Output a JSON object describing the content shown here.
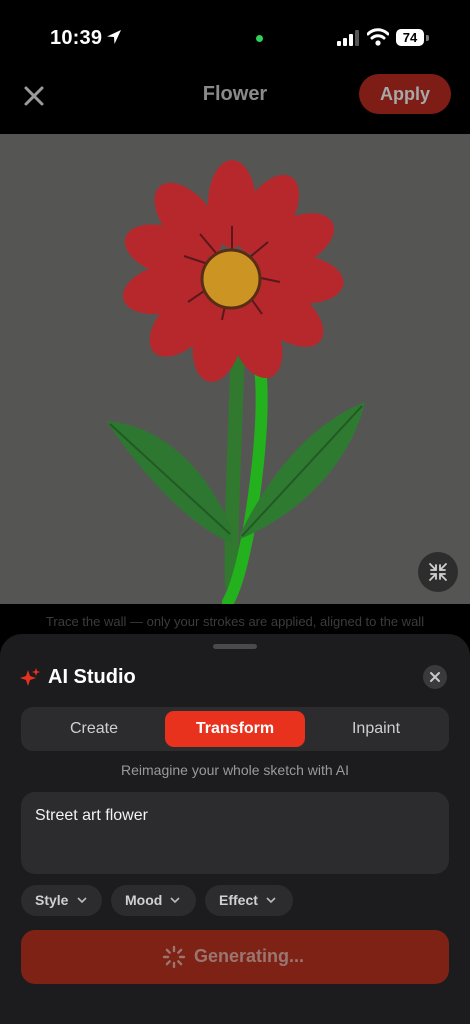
{
  "status_bar": {
    "time": "10:39",
    "battery": "74"
  },
  "header": {
    "title": "Flower",
    "apply_label": "Apply"
  },
  "canvas": {
    "hint": "Trace the wall — only your strokes are applied, aligned to the wall"
  },
  "ai_studio": {
    "title": "AI Studio",
    "tabs": [
      {
        "label": "Create",
        "active": false
      },
      {
        "label": "Transform",
        "active": true
      },
      {
        "label": "Inpaint",
        "active": false
      }
    ],
    "subtitle": "Reimagine your whole sketch with AI",
    "prompt_value": "Street art flower",
    "chips": [
      {
        "label": "Style"
      },
      {
        "label": "Mood"
      },
      {
        "label": "Effect"
      }
    ],
    "generate_label": "Generating..."
  },
  "colors": {
    "accent": "#e8321e",
    "apply_bg": "#7d1d15",
    "generate_bg": "#7e2216",
    "sheet_bg": "#1c1c1e"
  }
}
